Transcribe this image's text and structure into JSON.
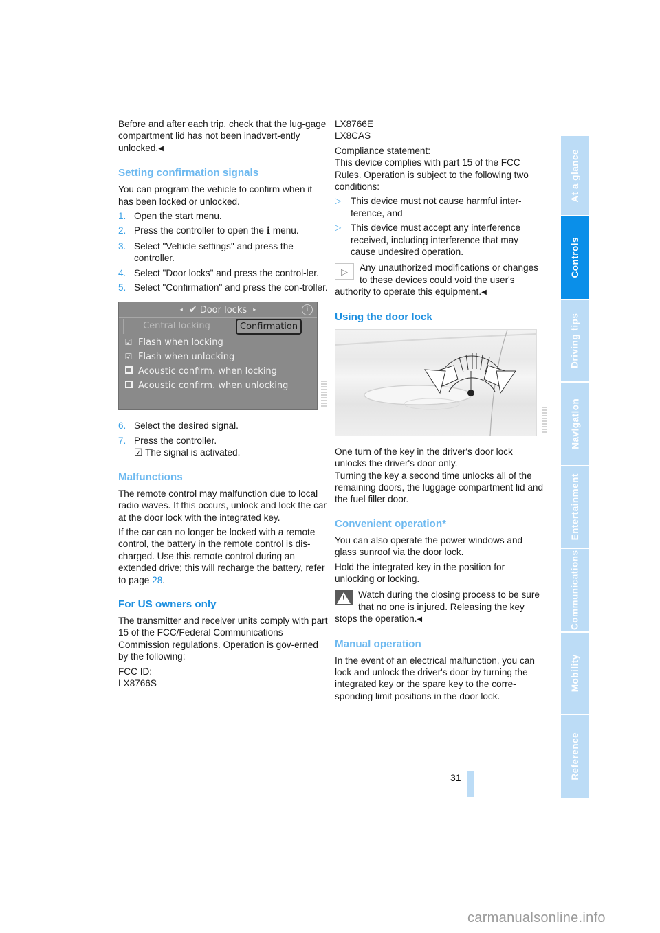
{
  "left_column": {
    "intro_text": "Before and after each trip, check that the lug-gage compartment lid has not been inadvert-ently unlocked.",
    "end_mark": "◀",
    "setting_signals": {
      "heading": "Setting confirmation signals",
      "intro": "You can program the vehicle to confirm when it has been locked or unlocked.",
      "steps": [
        {
          "num": "1.",
          "text": "Open the start menu."
        },
        {
          "num": "2.",
          "text_before": "Press the controller to open the",
          "icon": "i",
          "text_after": "menu."
        },
        {
          "num": "3.",
          "text": "Select \"Vehicle settings\" and press the controller."
        },
        {
          "num": "4.",
          "text": "Select \"Door locks\" and press the control-ler."
        },
        {
          "num": "5.",
          "text": "Select \"Confirmation\" and press the con-troller."
        }
      ],
      "screen": {
        "title": "Door locks",
        "nav_left": "◂",
        "nav_right": "▸",
        "title_icon": "✔",
        "info_icon": "i",
        "tabs": [
          "Central locking",
          "Confirmation"
        ],
        "active_tab": "Confirmation",
        "options": [
          {
            "label": "Flash when locking",
            "checked": true
          },
          {
            "label": "Flash when unlocking",
            "checked": true
          },
          {
            "label": "Acoustic confirm. when locking",
            "checked": false
          },
          {
            "label": "Acoustic confirm. when unlocking",
            "checked": false
          }
        ]
      },
      "steps_after": [
        {
          "num": "6.",
          "text": "Select the desired signal."
        },
        {
          "num": "7.",
          "text": "Press the controller."
        }
      ],
      "activated_text": "The signal is activated.",
      "check_glyph": "☑"
    },
    "malfunctions": {
      "heading": "Malfunctions",
      "para1": "The remote control may malfunction due to local radio waves. If this occurs, unlock and lock the car at the door lock with the integrated key.",
      "para2_before": "If the car can no longer be locked with a remote control, the battery in the remote control is dis-charged. Use this remote control during an extended drive; this will recharge the battery, refer to page",
      "para2_link": "28",
      "para2_after": "."
    },
    "us_owners": {
      "heading": "For US owners only",
      "para": "The transmitter and receiver units comply with part 15 of the FCC/Federal Communications Commission regulations. Operation is gov-erned by the following:",
      "fcc_label": "FCC ID:",
      "fcc_id_1": "LX8766S"
    }
  },
  "right_column": {
    "fcc_id_2": "LX8766E",
    "fcc_id_3": "LX8CAS",
    "compliance_label": "Compliance statement:",
    "compliance_text": "This device complies with part 15 of the FCC Rules. Operation is subject to the following two conditions:",
    "bullet_glyph": "▷",
    "conditions": [
      "This device must not cause harmful inter-ference, and",
      "This device must accept any interference received, including interference that may cause undesired operation."
    ],
    "note_text": "Any unauthorized modifications or changes to these devices could void the user's authority to operate this equipment.",
    "note_icon": "▷",
    "door_lock": {
      "heading": "Using the door lock",
      "para1": "One turn of the key in the driver's door lock unlocks the driver's door only.",
      "para2": "Turning the key a second time unlocks all of the remaining doors, the luggage compartment lid and the fuel filler door."
    },
    "convenient": {
      "heading": "Convenient operation*",
      "para1": "You can also operate the power windows and glass sunroof via the door lock.",
      "para2": "Hold the integrated key in the position for unlocking or locking.",
      "warning": "Watch during the closing process to be sure that no one is injured. Releasing the key stops the operation.",
      "warning_icon": "!"
    },
    "manual": {
      "heading": "Manual operation",
      "para": "In the event of an electrical malfunction, you can lock and unlock the driver's door by turning the integrated key or the spare key to the corre-sponding limit positions in the door lock."
    }
  },
  "sidebar": {
    "tabs": [
      {
        "label": "At a glance",
        "active": false
      },
      {
        "label": "Controls",
        "active": true
      },
      {
        "label": "Driving tips",
        "active": false
      },
      {
        "label": "Navigation",
        "active": false
      },
      {
        "label": "Entertainment",
        "active": false
      },
      {
        "label": "Communications",
        "active": false
      },
      {
        "label": "Mobility",
        "active": false
      },
      {
        "label": "Reference",
        "active": false
      }
    ],
    "active_color": "#0a8fe9",
    "inactive_color": "#bcdcf6"
  },
  "footer": {
    "page_number": "31",
    "watermark": "carmanualsonline.info"
  }
}
